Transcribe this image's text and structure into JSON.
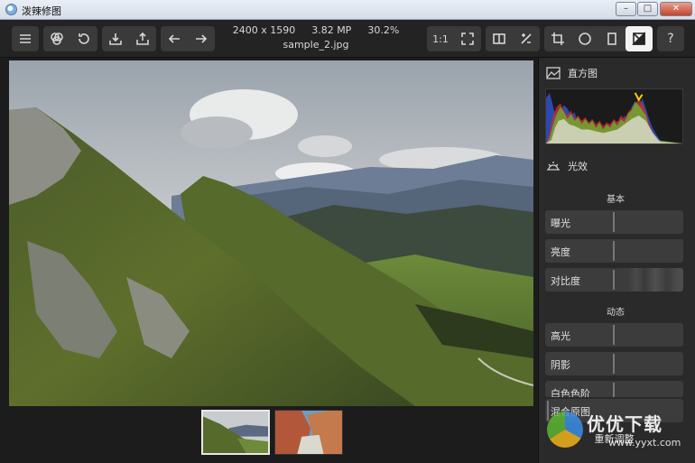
{
  "window": {
    "title": "泼辣修图",
    "minimize": "–",
    "maximize": "□",
    "close": "✕"
  },
  "toolbar": {
    "left_icons": [
      "menu-icon",
      "layers-icon",
      "history-icon",
      "import-icon",
      "export-icon",
      "undo-icon",
      "redo-icon"
    ],
    "zoom_label": "1:1",
    "right_icons": [
      "fit-icon",
      "compare-icon",
      "before-after-icon",
      "crop-icon",
      "vignette-icon",
      "frame-icon",
      "adjust-icon",
      "help-icon"
    ],
    "active_tool": "adjust-icon",
    "help_label": "?"
  },
  "image_info": {
    "dimensions": "2400 x 1590",
    "megapixels": "3.82 MP",
    "zoom": "30.2%",
    "filename": "sample_2.jpg"
  },
  "panel": {
    "histogram_label": "直方图",
    "light_label": "光效",
    "basic_group": "基本",
    "basic_sliders": [
      {
        "label": "曝光"
      },
      {
        "label": "亮度"
      },
      {
        "label": "对比度"
      }
    ],
    "dynamic_group": "动态",
    "dynamic_sliders": [
      {
        "label": "高光"
      },
      {
        "label": "阴影"
      },
      {
        "label": "白色色阶"
      },
      {
        "label": "混合原图"
      }
    ],
    "reset_label": "重新调整"
  },
  "watermark": {
    "brand": "优优下载",
    "url": "www.yyxt.com"
  },
  "colors": {
    "panel_bg": "#2a2a2a",
    "slider_bg": "#3c3c3c",
    "toolbar_bg": "#232323",
    "active_tool_bg": "#f2f2f2"
  }
}
